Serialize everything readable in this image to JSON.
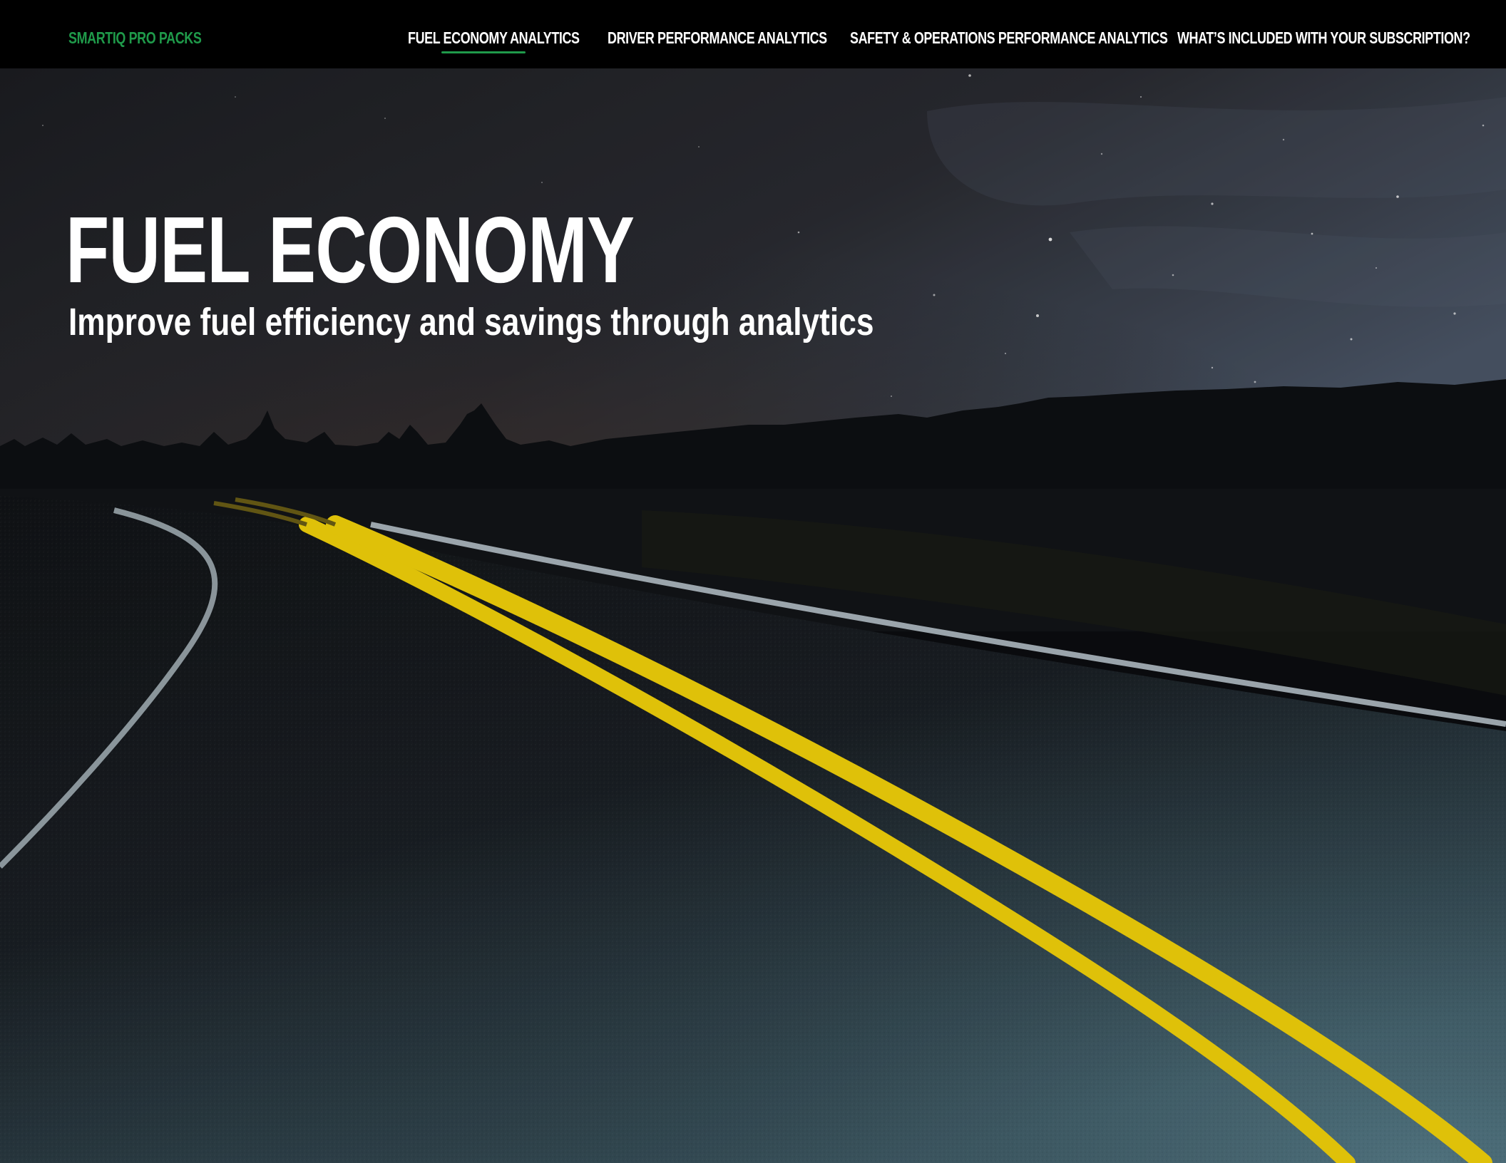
{
  "nav": {
    "brand": "SMARTIQ PRO PACKS",
    "items": [
      {
        "label": "FUEL ECONOMY ANALYTICS",
        "active": true
      },
      {
        "label": "DRIVER PERFORMANCE ANALYTICS",
        "active": false
      },
      {
        "label": "SAFETY & OPERATIONS PERFORMANCE ANALYTICS",
        "active": false
      },
      {
        "label": "WHAT’S INCLUDED WITH YOUR SUBSCRIPTION?",
        "active": false
      }
    ]
  },
  "hero": {
    "title": "FUEL ECONOMY",
    "subtitle": "Improve fuel efficiency and savings through analytics",
    "background_icon": "night-road-photo"
  },
  "colors": {
    "brand_green": "#1f9a4a",
    "nav_background": "#000000",
    "road_line_yellow": "#f2d20a",
    "text": "#ffffff"
  }
}
